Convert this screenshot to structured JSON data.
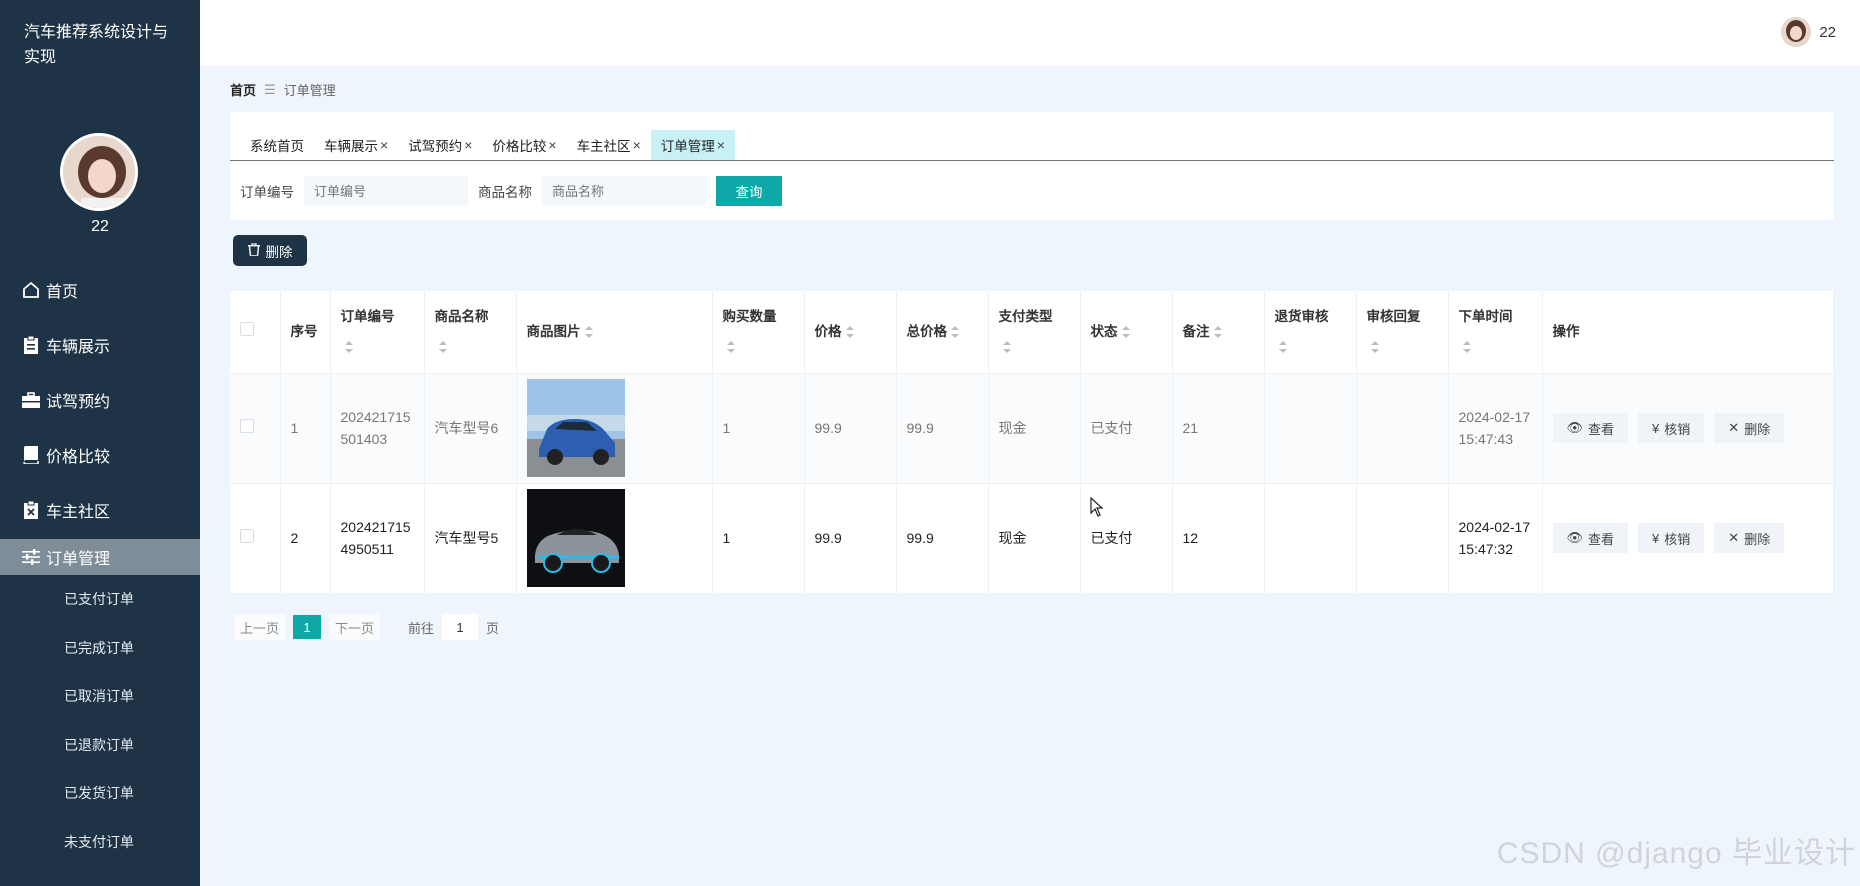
{
  "app": {
    "title": "汽车推荐系统设计与实现"
  },
  "sidebar": {
    "user_name": "22",
    "items": [
      {
        "label": "首页",
        "icon": "home-icon"
      },
      {
        "label": "车辆展示",
        "icon": "clipboard-icon"
      },
      {
        "label": "试驾预约",
        "icon": "briefcase-icon"
      },
      {
        "label": "价格比较",
        "icon": "book-icon"
      },
      {
        "label": "车主社区",
        "icon": "clipboard-x-icon"
      },
      {
        "label": "订单管理",
        "icon": "sliders-icon"
      }
    ],
    "subitems": [
      "已支付订单",
      "已完成订单",
      "已取消订单",
      "已退款订单",
      "已发货订单",
      "未支付订单"
    ]
  },
  "header": {
    "user_name": "22"
  },
  "breadcrumb": {
    "home": "首页",
    "current": "订单管理"
  },
  "tabs": [
    {
      "label": "系统首页",
      "closable": false
    },
    {
      "label": "车辆展示",
      "closable": true
    },
    {
      "label": "试驾预约",
      "closable": true
    },
    {
      "label": "价格比较",
      "closable": true
    },
    {
      "label": "车主社区",
      "closable": true
    },
    {
      "label": "订单管理",
      "closable": true
    }
  ],
  "search": {
    "order_label": "订单编号",
    "order_placeholder": "订单编号",
    "product_label": "商品名称",
    "product_placeholder": "商品名称",
    "query_label": "查询"
  },
  "toolbar": {
    "delete_label": "删除"
  },
  "table": {
    "headers": [
      "序号",
      "订单编号",
      "商品名称",
      "商品图片",
      "购买数量",
      "价格",
      "总价格",
      "支付类型",
      "状态",
      "备注",
      "退货审核",
      "审核回复",
      "下单时间",
      "操作"
    ],
    "rows": [
      {
        "index": "1",
        "order_no": "202421715501403",
        "product": "汽车型号6",
        "qty": "1",
        "price": "99.9",
        "total": "99.9",
        "pay_type": "现金",
        "status": "已支付",
        "note": "21",
        "return_review": "",
        "review_reply": "",
        "time": "2024-02-17 15:47:43"
      },
      {
        "index": "2",
        "order_no": "2024217154950511",
        "product": "汽车型号5",
        "qty": "1",
        "price": "99.9",
        "total": "99.9",
        "pay_type": "现金",
        "status": "已支付",
        "note": "12",
        "return_review": "",
        "review_reply": "",
        "time": "2024-02-17 15:47:32"
      }
    ],
    "actions": {
      "view": "查看",
      "cancel": "核销",
      "delete": "删除"
    }
  },
  "pagination": {
    "prev": "上一页",
    "current": "1",
    "next": "下一页",
    "goto_prefix": "前往",
    "goto_value": "1",
    "goto_suffix": "页"
  },
  "watermark": "CSDN @django 毕业设计",
  "colors": {
    "sidebar": "#1f3346",
    "accent": "#0fa8a8",
    "active_tab": "#c8f1f5"
  }
}
